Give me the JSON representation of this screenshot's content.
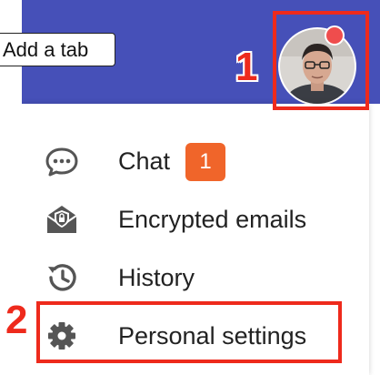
{
  "header": {
    "background_color": "#4650b8",
    "tab_tooltip": "Add a tab"
  },
  "user": {
    "avatar_icon": "user-avatar-photo",
    "notification_color": "#ef4d4d"
  },
  "menu": {
    "items": [
      {
        "label": "Chat",
        "icon": "chat-bubble-icon",
        "badge": "1"
      },
      {
        "label": "Encrypted emails",
        "icon": "encrypted-envelope-icon"
      },
      {
        "label": "History",
        "icon": "history-icon"
      },
      {
        "label": "Personal settings",
        "icon": "gear-icon"
      }
    ],
    "badge_color": "#f0652a"
  },
  "annotations": {
    "color": "#ee2a1c",
    "steps": [
      "1",
      "2"
    ]
  }
}
